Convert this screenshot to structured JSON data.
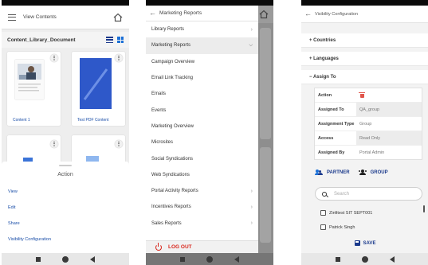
{
  "colors": {
    "accent": "#1b3a8c",
    "link": "#1a4ea8",
    "danger": "#d9281e"
  },
  "screen1": {
    "header_title": "View Contents",
    "library_title": "Content_Library_Document",
    "cards": [
      {
        "label": "Content 1",
        "thumb_icon": "person-photo"
      },
      {
        "label": "Test PDF Content",
        "thumb_icon": "pdf-document"
      }
    ],
    "sheet": {
      "title": "Action",
      "items": [
        "View",
        "Edit",
        "Share",
        "Visibility Configuration"
      ]
    }
  },
  "screen2": {
    "drawer_title": "Marketing Reports",
    "menu": [
      {
        "label": "Library Reports",
        "chevron": "right"
      },
      {
        "label": "Marketing Reports",
        "chevron": "down",
        "selected": true
      },
      {
        "label": "Campaign Overview"
      },
      {
        "label": "Email Link Tracking"
      },
      {
        "label": "Emails"
      },
      {
        "label": "Events"
      },
      {
        "label": "Marketing Overview"
      },
      {
        "label": "Microsites"
      },
      {
        "label": "Social Syndications"
      },
      {
        "label": "Web Syndications"
      },
      {
        "label": "Portal Activity Reports",
        "chevron": "right"
      },
      {
        "label": "Incentives Reports",
        "chevron": "right"
      },
      {
        "label": "Sales Reports",
        "chevron": "right"
      }
    ],
    "logout_label": "LOG OUT"
  },
  "screen3": {
    "header_title": "Visibility Configuration",
    "sections": {
      "countries": "+ Countries",
      "languages": "+ Languages",
      "assign_to": "− Assign To"
    },
    "table": {
      "action_label": "Action",
      "assigned_to_label": "Assigned To",
      "assigned_to_value": "QA_group",
      "assignment_type_label": "Assignment Type",
      "assignment_type_value": "Group",
      "access_label": "Access",
      "access_value": "Read Only",
      "assigned_by_label": "Assigned By",
      "assigned_by_value": "Portal Admin"
    },
    "tabs": {
      "partner": "PARTNER",
      "group": "GROUP"
    },
    "search_placeholder": "Search",
    "partners": [
      "Zinfitest SIT SEPT001",
      "Patrick Singh"
    ],
    "save_label": "SAVE"
  }
}
